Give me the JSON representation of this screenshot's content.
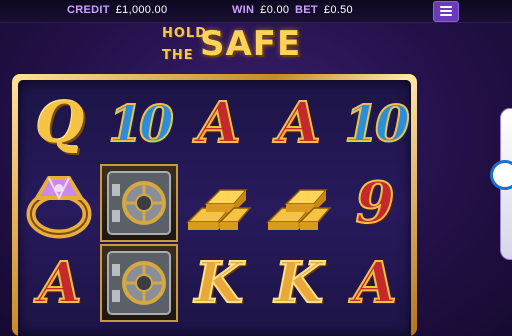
{
  "topbar": {
    "credit_label": "CREDIT",
    "credit_value": "£1,000.00",
    "win_label": "WIN",
    "win_value": "£0.00",
    "bet_label": "BET",
    "bet_value": "£0.50"
  },
  "logo": {
    "line1": "HOLD",
    "line2": "THE",
    "line3": "SAFE"
  },
  "reels": {
    "row1": [
      "Q",
      "10",
      "A",
      "A",
      "10"
    ],
    "row2": [
      "ring-symbol",
      "vault-symbol",
      "gold-bars-symbol",
      "gold-bars-symbol",
      "9"
    ],
    "row3": [
      "A",
      "vault-symbol",
      "K",
      "K",
      "A"
    ]
  },
  "colors": {
    "accent_purple": "#6a3bb8",
    "gold": "#f6c442",
    "frame_gold": "#c98a22"
  }
}
